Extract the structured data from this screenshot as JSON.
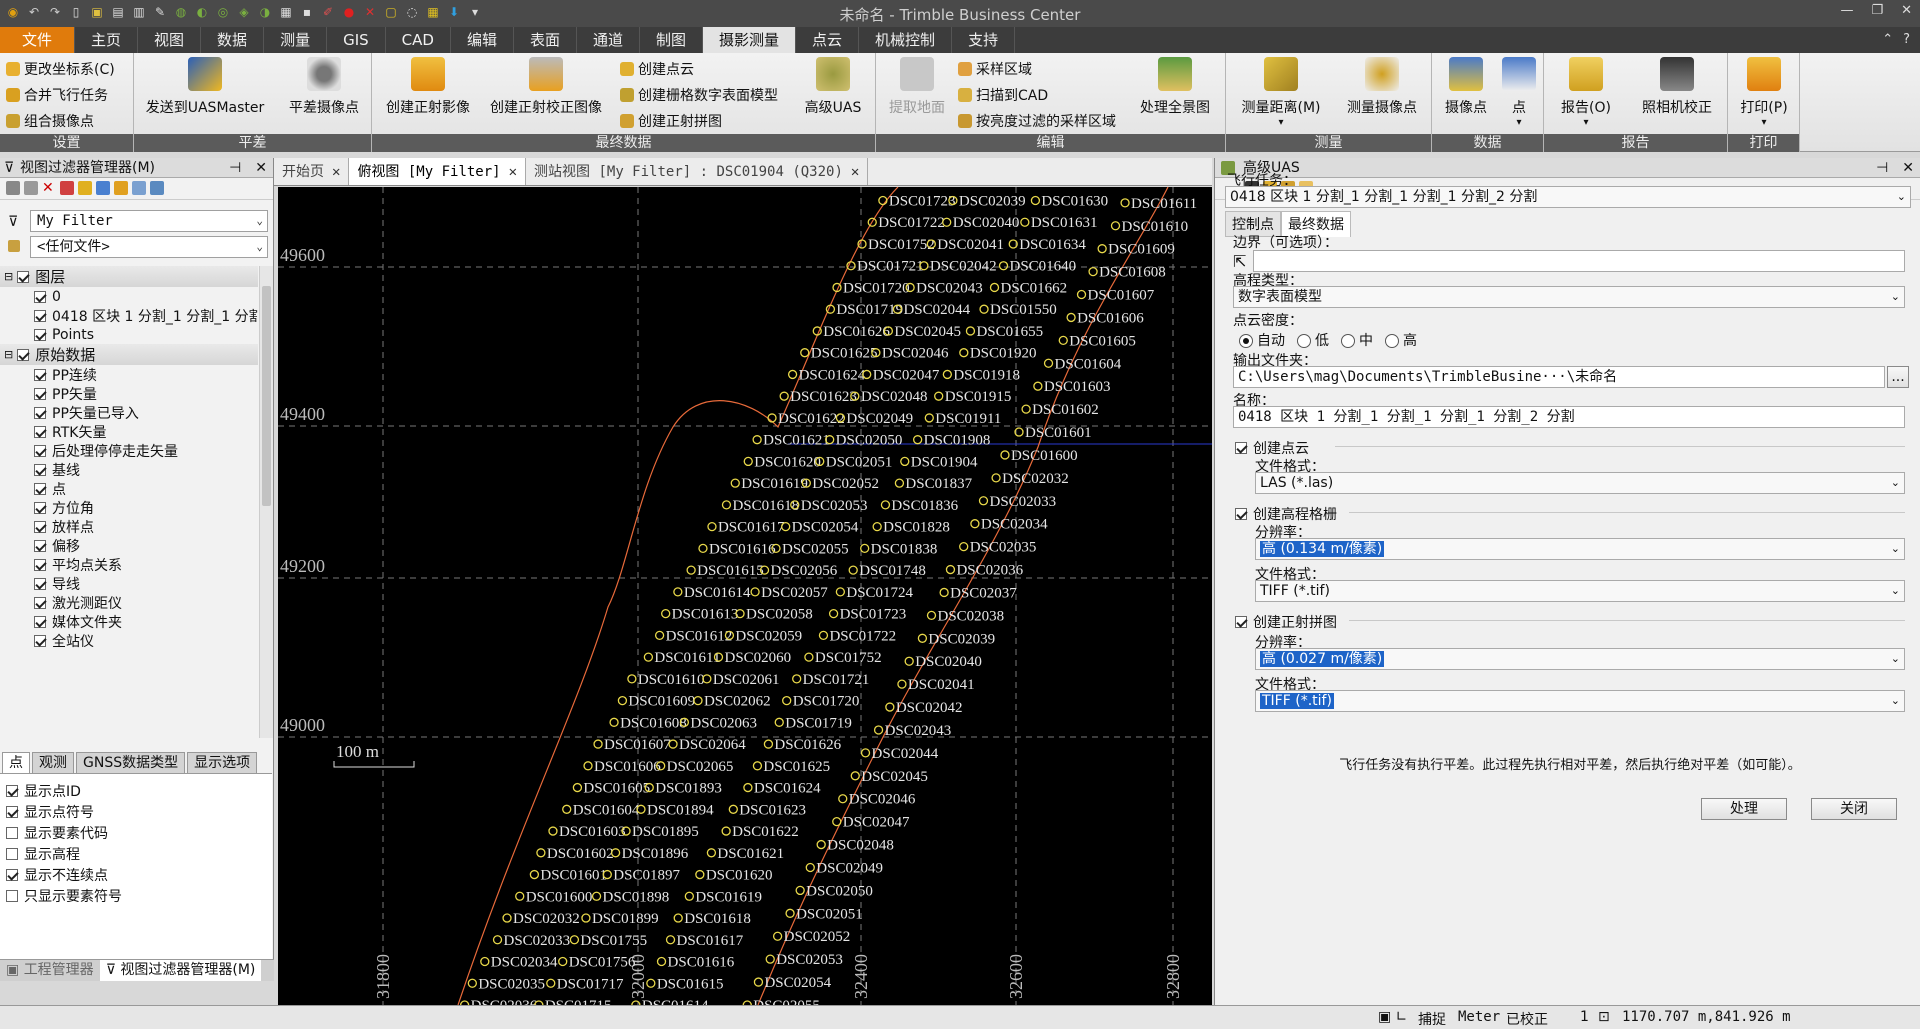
{
  "window": {
    "title": "未命名 - Trimble Business Center",
    "qat_icons": [
      "app-logo-icon",
      "undo-icon",
      "redo-icon",
      "new-icon",
      "save-icon",
      "open-icon",
      "document-icon",
      "tool-icon",
      "globe-icon",
      "survey-icon",
      "layers-icon",
      "network-icon",
      "view-icon",
      "config-icon",
      "terminal-icon",
      "pen-icon",
      "record-icon",
      "close-red-icon",
      "snap-icon",
      "zoom-icon",
      "grid-icon",
      "import-icon",
      "dropdown-icon"
    ]
  },
  "ribbon_tabs": [
    "文件",
    "主页",
    "视图",
    "数据",
    "测量",
    "GIS",
    "CAD",
    "编辑",
    "表面",
    "通道",
    "制图",
    "摄影测量",
    "点云",
    "机械控制",
    "支持"
  ],
  "active_tab": "摄影测量",
  "ribbon": {
    "group_settings": {
      "label": "设置",
      "items": [
        "更改坐标系(C)",
        "合并飞行任务",
        "组合摄像点"
      ]
    },
    "group_adjust": {
      "label": "平差",
      "items": [
        "发送到UASMaster",
        "平差摄像点"
      ]
    },
    "group_final": {
      "label": "最终数据",
      "items": [
        "创建正射影像",
        "创建正射校正图像"
      ],
      "small": [
        "创建点云",
        "创建栅格数字表面模型",
        "创建正射拼图"
      ],
      "big_last": "高级UAS"
    },
    "group_edit": {
      "label": "编辑",
      "extract": "提取地面",
      "small": [
        "采样区域",
        "扫描到CAD",
        "按亮度过滤的采样区域"
      ],
      "panorama": "处理全景图"
    },
    "group_measure": {
      "label": "测量",
      "items": [
        "测量距离(M)",
        "测量摄像点"
      ]
    },
    "group_data": {
      "label": "数据",
      "items": [
        "摄像点",
        "点"
      ]
    },
    "group_report": {
      "label": "报告",
      "items": [
        "报告(O)",
        "照相机校正"
      ]
    },
    "group_print": {
      "label": "打印",
      "items": [
        "打印(P)"
      ]
    }
  },
  "left_panel": {
    "title": "视图过滤器管理器(M)",
    "filter_value": "My Filter",
    "file_value": "<任何文件>",
    "tree": [
      {
        "group": true,
        "label": "图层",
        "checked": true
      },
      {
        "label": "0",
        "checked": true
      },
      {
        "label": "0418 区块 1 分割_1 分割_1 分割_1 分",
        "checked": true
      },
      {
        "label": "Points",
        "checked": true
      },
      {
        "group": true,
        "label": "原始数据",
        "checked": true
      },
      {
        "label": "PP连续",
        "checked": true
      },
      {
        "label": "PP矢量",
        "checked": true
      },
      {
        "label": "PP矢量已导入",
        "checked": true
      },
      {
        "label": "RTK矢量",
        "checked": true
      },
      {
        "label": "后处理停停走走矢量",
        "checked": true
      },
      {
        "label": "基线",
        "checked": true
      },
      {
        "label": "点",
        "checked": true
      },
      {
        "label": "方位角",
        "checked": true
      },
      {
        "label": "放样点",
        "checked": true
      },
      {
        "label": "偏移",
        "checked": true
      },
      {
        "label": "平均点关系",
        "checked": true
      },
      {
        "label": "导线",
        "checked": true
      },
      {
        "label": "激光测距仪",
        "checked": true
      },
      {
        "label": "媒体文件夹",
        "checked": true
      },
      {
        "label": "全站仪",
        "checked": true
      }
    ],
    "sub_tabs": [
      "点",
      "观测",
      "GNSS数据类型",
      "显示选项"
    ],
    "options": [
      {
        "label": "显示点ID",
        "checked": true
      },
      {
        "label": "显示点符号",
        "checked": true
      },
      {
        "label": "显示要素代码",
        "checked": false
      },
      {
        "label": "显示高程",
        "checked": false
      },
      {
        "label": "显示不连续点",
        "checked": true
      },
      {
        "label": "只显示要素符号",
        "checked": false
      }
    ],
    "bottom_tabs": [
      "工程管理器",
      "视图过滤器管理器(M)"
    ]
  },
  "doc_tabs": [
    {
      "label": "开始页",
      "active": false,
      "closable": true
    },
    {
      "label": "俯视图 [My Filter]",
      "active": true,
      "closable": true
    },
    {
      "label": "测站视图 [My Filter] : DSC01904 (Q320)",
      "active": false,
      "closable": true
    }
  ],
  "map": {
    "y_ticks": [
      "49600",
      "49400",
      "49200",
      "49000"
    ],
    "x_ticks": [
      "31800",
      "32000",
      "32400",
      "32600",
      "32800"
    ],
    "scale_label": "100 m",
    "point_labels": [
      "DSC01748",
      "DSC01724",
      "DSC01723",
      "DSC01722",
      "DSC01752",
      "DSC01721",
      "DSC01720",
      "DSC01719",
      "DSC01626",
      "DSC01625",
      "DSC01624",
      "DSC01623",
      "DSC01622",
      "DSC01621",
      "DSC01620",
      "DSC01619",
      "DSC01618",
      "DSC01617",
      "DSC01616",
      "DSC01615",
      "DSC01614",
      "DSC01613",
      "DSC01612",
      "DSC01611",
      "DSC01610",
      "DSC01609",
      "DSC01608",
      "DSC01607",
      "DSC01606",
      "DSC01605",
      "DSC01604",
      "DSC01603",
      "DSC01602",
      "DSC01601",
      "DSC01600",
      "DSC02032",
      "DSC02033",
      "DSC02034",
      "DSC02035",
      "DSC02036",
      "DSC02037",
      "DSC02038",
      "DSC02039",
      "DSC02040",
      "DSC02041",
      "DSC02042",
      "DSC02043",
      "DSC02044",
      "DSC02045",
      "DSC02046",
      "DSC02047",
      "DSC02048",
      "DSC02049",
      "DSC02050",
      "DSC02051",
      "DSC02052",
      "DSC02053",
      "DSC02054",
      "DSC02055",
      "DSC02056",
      "DSC02057",
      "DSC02058",
      "DSC02059",
      "DSC02060",
      "DSC02061",
      "DSC02062",
      "DSC02063",
      "DSC02064",
      "DSC02065",
      "DSC01893",
      "DSC01894",
      "DSC01895",
      "DSC01896",
      "DSC01897",
      "DSC01898",
      "DSC01899",
      "DSC01755",
      "DSC01756",
      "DSC01717",
      "DSC01715",
      "DSC01754",
      "DSC01753",
      "DSC01630",
      "DSC01631",
      "DSC01634",
      "DSC01640",
      "DSC01662",
      "DSC01550",
      "DSC01655",
      "DSC01920",
      "DSC01918",
      "DSC01915",
      "DSC01911",
      "DSC01908",
      "DSC01904",
      "DSC01837",
      "DSC01836",
      "DSC01828",
      "DSC01838"
    ]
  },
  "right_panel": {
    "title": "高级UAS",
    "flight_label": "飞行任务：",
    "flight_value": "0418 区块 1 分割_1 分割_1 分割_1 分割_2 分割",
    "tabs": [
      "控制点",
      "最终数据"
    ],
    "active_tab": "最终数据",
    "boundary_label": "边界（可选项）：",
    "boundary_value": "",
    "elev_type_label": "高程类型：",
    "elev_type_value": "数字表面模型",
    "density_label": "点云密度：",
    "density_options": [
      "自动",
      "低",
      "中",
      "高"
    ],
    "density_selected": "自动",
    "output_folder_label": "输出文件夹：",
    "output_folder_value": "C:\\Users\\mag\\Documents\\TrimbleBusine···\\未命名",
    "browse_label": "...",
    "name_label": "名称：",
    "name_value": "0418 区块 1 分割_1 分割_1 分割_1 分割_2 分割",
    "create_pointcloud": {
      "label": "创建点云",
      "checked": true,
      "format_label": "文件格式：",
      "format_value": "LAS (*.las)"
    },
    "create_grid": {
      "label": "创建高程格栅",
      "checked": true,
      "res_label": "分辨率：",
      "res_value": "高 (0.134 m/像素)",
      "format_label": "文件格式：",
      "format_value": "TIFF (*.tif)"
    },
    "create_ortho": {
      "label": "创建正射拼图",
      "checked": true,
      "res_label": "分辨率：",
      "res_value": "高 (0.027 m/像素)",
      "format_label": "文件格式：",
      "format_value": "TIFF (*.tif)"
    },
    "note": "飞行任务没有执行平差。此过程先执行相对平差，然后执行绝对平差（如可能）。",
    "process_button": "处理",
    "close_button": "关闭"
  },
  "status_bar": {
    "snap": "捕捉",
    "unit": "Meter",
    "calibrated": "已校正",
    "count": "1",
    "coords": "1170.707 m,841.926 m"
  },
  "colors": {
    "file_tab": "#e07b0c",
    "titlebar": "#4a4a4a",
    "map_bg": "#000000",
    "point_symbol": "#e8d84a",
    "boundary_line": "#e86a3a",
    "selection": "#1e64c8"
  }
}
